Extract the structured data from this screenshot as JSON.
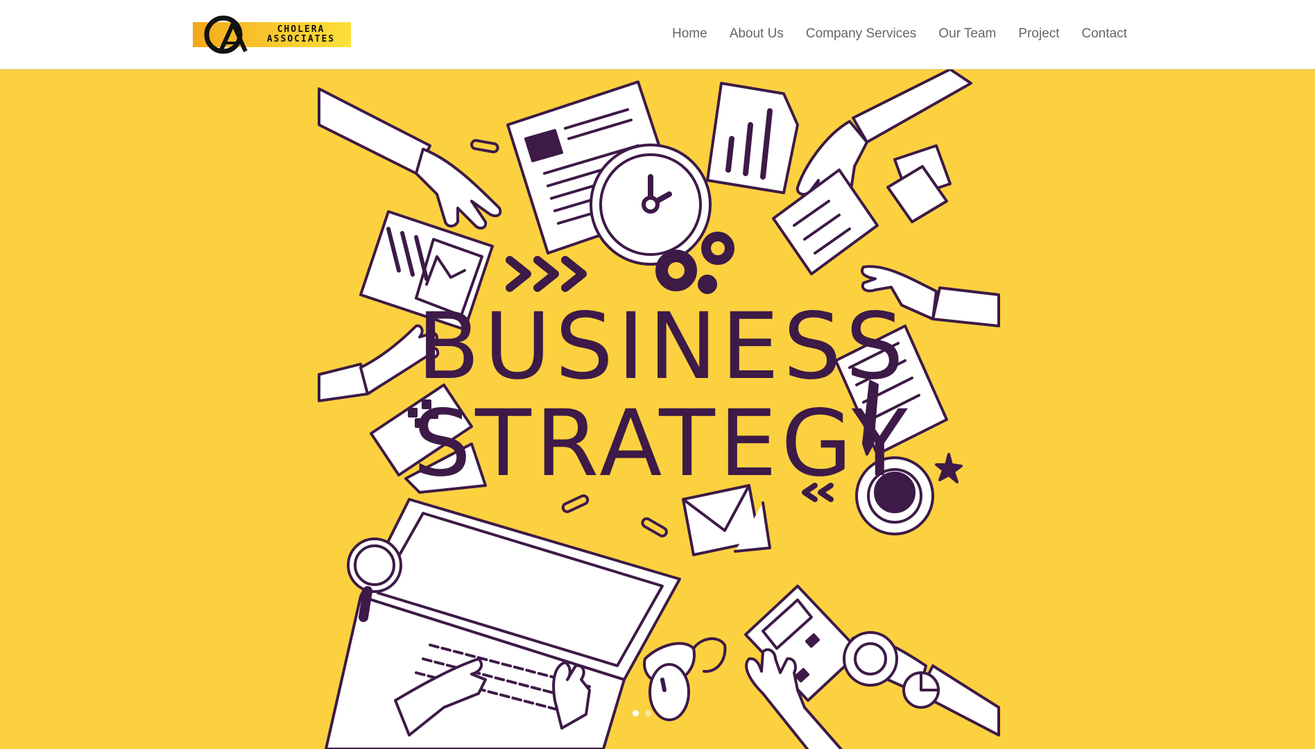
{
  "header": {
    "logo": {
      "monogram": "CA",
      "line1": "CHOLERA",
      "line2": "ASSOCIATES"
    },
    "nav": [
      {
        "label": "Home"
      },
      {
        "label": "About Us"
      },
      {
        "label": "Company Services"
      },
      {
        "label": "Our Team"
      },
      {
        "label": "Project"
      },
      {
        "label": "Contact"
      }
    ]
  },
  "hero": {
    "background_color": "#fcd140",
    "ink_color": "#3d1a47",
    "title_line1": "BUSINESS",
    "title_line2": "STRATEGY",
    "slider": {
      "slides": 2,
      "active": 1
    }
  }
}
